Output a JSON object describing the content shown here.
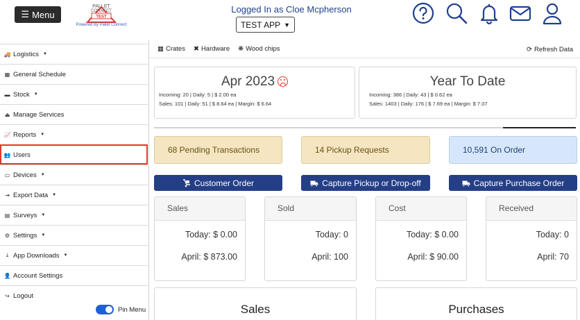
{
  "header": {
    "menu_label": "Menu",
    "logo_top": "PALLET",
    "logo_mid": "CONNECT",
    "logo_badge": "TEST",
    "powered_by": "Powered By Pallet Connect",
    "user_line": "Logged In as Cloe Mcpherson",
    "app_select_value": "TEST APP",
    "icons": [
      "help-icon",
      "search-icon",
      "bell-icon",
      "mail-icon",
      "user-icon"
    ]
  },
  "sidebar": {
    "items": [
      {
        "label": "Logistics",
        "icon": "truck-icon",
        "caret": true
      },
      {
        "label": "General Schedule",
        "icon": "calendar-icon",
        "caret": false
      },
      {
        "label": "Stock",
        "icon": "pallet-icon",
        "caret": true
      },
      {
        "label": "Manage Services",
        "icon": "eject-icon",
        "caret": false
      },
      {
        "label": "Reports",
        "icon": "chart-icon",
        "caret": true
      },
      {
        "label": "Users",
        "icon": "users-icon",
        "caret": false
      },
      {
        "label": "Devices",
        "icon": "monitor-icon",
        "caret": true
      },
      {
        "label": "Export Data",
        "icon": "export-icon",
        "caret": true
      },
      {
        "label": "Surveys",
        "icon": "survey-icon",
        "caret": true
      },
      {
        "label": "Settings",
        "icon": "cogs-icon",
        "caret": true
      },
      {
        "label": "App Downloads",
        "icon": "download-icon",
        "caret": true
      },
      {
        "label": "Account Settings",
        "icon": "account-icon",
        "caret": false
      },
      {
        "label": "Logout",
        "icon": "logout-icon",
        "caret": false
      }
    ],
    "pin_label": "Pin Menu"
  },
  "topbar": {
    "categories": [
      "Crates",
      "Hardware",
      "Wood chips"
    ],
    "refresh_label": "Refresh Data"
  },
  "summary": {
    "month": {
      "title": "Apr 2023",
      "incoming": "Incoming: 20 | Daily: 5 | $ 2.00 ea",
      "sales": "Sales: 101 | Daily: 51 | $ 8.64 ea | Margin: $ 6.64"
    },
    "ytd": {
      "title": "Year To Date",
      "incoming": "Incoming: 386 | Daily: 43 | $ 0.62 ea",
      "sales": "Sales: 1403 | Daily: 176 | $ 7.69 ea | Margin: $ 7.07"
    }
  },
  "status": {
    "pending": "68 Pending Transactions",
    "pickups": "14 Pickup Requests",
    "on_order": "10,591 On Order"
  },
  "actions": {
    "customer_order": "Customer Order",
    "capture_pickup": "Capture Pickup or Drop-off",
    "capture_purchase": "Capture Purchase Order"
  },
  "stats": [
    {
      "title": "Sales",
      "today": "Today: $ 0.00",
      "month": "April: $ 873.00"
    },
    {
      "title": "Sold",
      "today": "Today: 0",
      "month": "April: 100"
    },
    {
      "title": "Cost",
      "today": "Today: $ 0.00",
      "month": "April: $ 90.00"
    },
    {
      "title": "Received",
      "today": "Today: 0",
      "month": "April: 70"
    }
  ],
  "panels": {
    "sales": "Sales",
    "purchases": "Purchases"
  }
}
